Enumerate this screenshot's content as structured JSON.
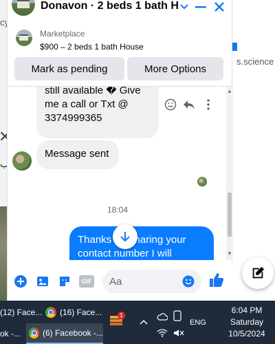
{
  "background": {
    "left_fragment_1": "cy",
    "left_fragment_2": "ب",
    "right_fragment": "s.science"
  },
  "chat": {
    "title": "Donavon · 2 beds 1 bath H...",
    "marketplace": {
      "label": "Marketplace",
      "listing": "$900 – 2 beds 1 bath House"
    },
    "buttons": {
      "mark_pending": "Mark as pending",
      "more_options": "More Options"
    },
    "messages": [
      {
        "from": "contact",
        "text_lines": [
          "still available � Give",
          "me a call or Txt @",
          "3374999365"
        ]
      },
      {
        "from": "contact",
        "text_lines": [
          "Message sent"
        ]
      },
      {
        "from": "me",
        "text_lines": [
          "Thanks for sharing your",
          "contact number I will"
        ]
      }
    ],
    "timestamp": "18:04",
    "composer": {
      "placeholder": "Aa",
      "gif_label": "GIF"
    }
  },
  "taskbar": {
    "items": [
      {
        "label": "(12) Face...",
        "partial_left": true
      },
      {
        "label": "(16) Face..."
      },
      {
        "label": "ok -..."
      },
      {
        "label": "(6) Facebook -..."
      }
    ],
    "notification_count": "1",
    "language": "ENG",
    "time": "6:04 PM",
    "day": "Saturday",
    "date": "10/5/2024"
  },
  "colors": {
    "accent": "#1877f2",
    "bubble_out": "#0a7cff",
    "bubble_in": "#f0f0f0",
    "taskbar": "#1f2a3a"
  }
}
